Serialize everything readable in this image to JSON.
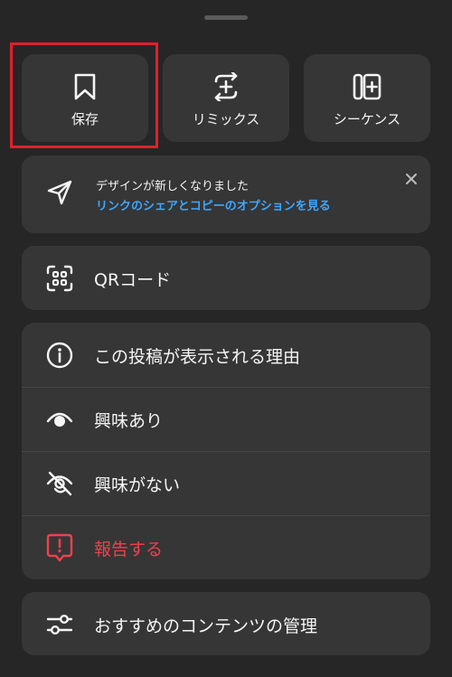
{
  "top_actions": {
    "save": {
      "label": "保存"
    },
    "remix": {
      "label": "リミックス"
    },
    "sequence": {
      "label": "シーケンス"
    }
  },
  "notice": {
    "title": "デザインが新しくなりました",
    "link": "リンクのシェアとコピーのオプションを見る"
  },
  "qr": {
    "label": "QRコード"
  },
  "menu": {
    "why": "この投稿が表示される理由",
    "interested": "興味あり",
    "not_interested": "興味がない",
    "report": "報告する"
  },
  "manage": {
    "label": "おすすめのコンテンツの管理"
  },
  "colors": {
    "background": "#262626",
    "card": "#363636",
    "link": "#3fa6ff",
    "danger": "#f0404c",
    "highlight": "#e0202a"
  }
}
